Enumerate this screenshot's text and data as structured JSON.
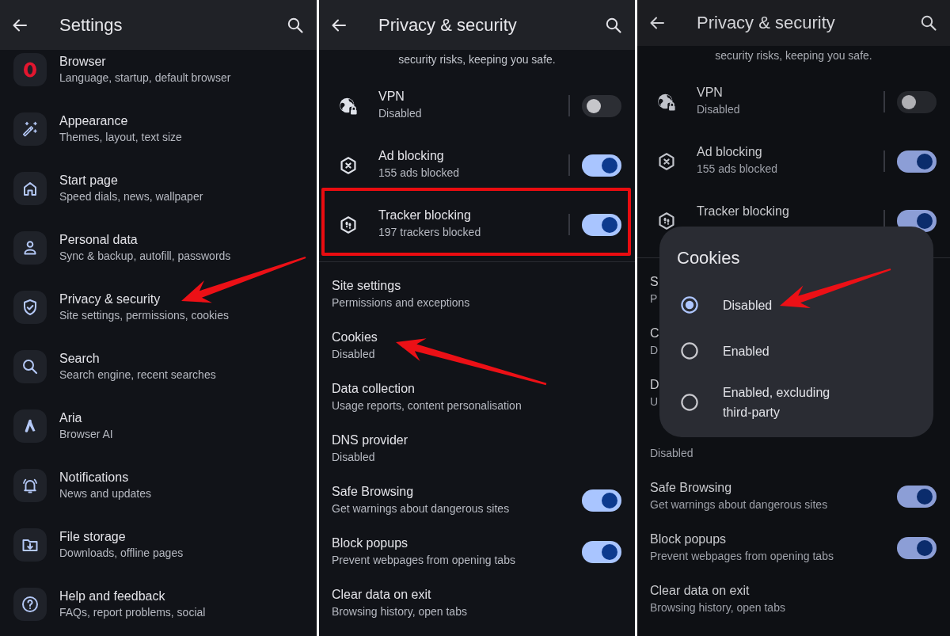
{
  "screens": [
    {
      "kind": "settings",
      "title": "Settings",
      "items": [
        {
          "title": "Browser",
          "subtitle": "Language, startup, default browser",
          "arrow": false
        },
        {
          "title": "Appearance",
          "subtitle": "Themes, layout, text size",
          "arrow": false
        },
        {
          "title": "Start page",
          "subtitle": "Speed dials, news, wallpaper",
          "arrow": false
        },
        {
          "title": "Personal data",
          "subtitle": "Sync & backup, autofill, passwords",
          "arrow": false
        },
        {
          "title": "Privacy & security",
          "subtitle": "Site settings, permissions, cookies",
          "arrow": true
        },
        {
          "title": "Search",
          "subtitle": "Search engine, recent searches",
          "arrow": false
        },
        {
          "title": "Aria",
          "subtitle": "Browser AI",
          "arrow": false
        },
        {
          "title": "Notifications",
          "subtitle": "News and updates",
          "arrow": false
        },
        {
          "title": "File storage",
          "subtitle": "Downloads, offline pages",
          "arrow": false
        },
        {
          "title": "Help and feedback",
          "subtitle": "FAQs, report problems, social",
          "arrow": false
        }
      ]
    },
    {
      "kind": "privacy",
      "title": "Privacy & security",
      "intro": "security risks, keeping you safe.",
      "sections": [
        {
          "items": [
            {
              "kind": "switch",
              "title": "VPN",
              "subtitle": "Disabled",
              "on": false,
              "highlighted": false
            },
            {
              "kind": "switch",
              "title": "Ad blocking",
              "subtitle": "155 ads blocked",
              "on": true,
              "highlighted": false
            },
            {
              "kind": "switch",
              "title": "Tracker blocking",
              "subtitle": "197 trackers blocked",
              "on": true,
              "highlighted": true
            }
          ]
        },
        {
          "items": [
            {
              "kind": "link",
              "title": "Site settings",
              "subtitle": "Permissions and exceptions",
              "arrow": false
            },
            {
              "kind": "link",
              "title": "Cookies",
              "subtitle": "Disabled",
              "arrow": true
            },
            {
              "kind": "link",
              "title": "Data collection",
              "subtitle": "Usage reports, content personalisation",
              "arrow": false
            },
            {
              "kind": "link",
              "title": "DNS provider",
              "subtitle": "Disabled",
              "arrow": false
            },
            {
              "kind": "switch",
              "title": "Safe Browsing",
              "subtitle": "Get warnings about dangerous sites",
              "on": true,
              "arrow": false
            },
            {
              "kind": "switch",
              "title": "Block popups",
              "subtitle": "Prevent webpages from opening tabs",
              "on": true,
              "arrow": false
            },
            {
              "kind": "link",
              "title": "Clear data on exit",
              "subtitle": "Browsing history, open tabs",
              "arrow": false
            }
          ]
        }
      ]
    },
    {
      "kind": "privacy",
      "title": "Privacy & security",
      "intro": "security risks, keeping you safe.",
      "sections": [
        {
          "items": [
            {
              "kind": "switch",
              "title": "VPN",
              "subtitle": "Disabled",
              "on": false,
              "highlighted": false
            },
            {
              "kind": "switch",
              "title": "Ad blocking",
              "subtitle": "155 ads blocked",
              "on": true,
              "highlighted": false
            },
            {
              "kind": "switch",
              "title": "Tracker blocking",
              "on": true,
              "highlighted": false
            }
          ]
        },
        {
          "items": [
            {
              "kind": "link",
              "title": "S",
              "subtitle": "P",
              "arrow": false
            },
            {
              "kind": "link",
              "title": "C",
              "subtitle": "D",
              "arrow": false
            },
            {
              "kind": "link",
              "title": "D",
              "subtitle": "U",
              "arrow": false
            },
            {
              "kind": "link",
              "subtitle": "Disabled",
              "arrow": false
            },
            {
              "kind": "switch",
              "title": "Safe Browsing",
              "subtitle": "Get warnings about dangerous sites",
              "on": true,
              "arrow": false
            },
            {
              "kind": "switch",
              "title": "Block popups",
              "subtitle": "Prevent webpages from opening tabs",
              "on": true,
              "arrow": false
            },
            {
              "kind": "link",
              "title": "Clear data on exit",
              "subtitle": "Browsing history, open tabs",
              "arrow": false
            }
          ]
        }
      ],
      "dialog": {
        "title": "Cookies",
        "options": [
          {
            "label": "Disabled",
            "selected": true,
            "arrow": true
          },
          {
            "label": "Enabled",
            "selected": false,
            "arrow": false
          },
          {
            "label": "Enabled, excluding third-party",
            "selected": false,
            "arrow": false
          }
        ]
      }
    }
  ]
}
